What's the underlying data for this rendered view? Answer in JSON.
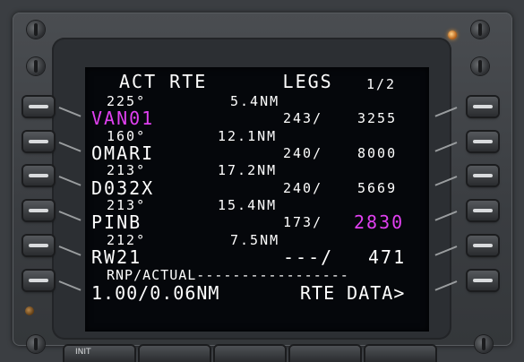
{
  "cdu": {
    "title": "ACT RTE      LEGS",
    "page": "1/2",
    "legs": [
      {
        "course": "225°",
        "distance": "5.4NM",
        "waypoint": "VAN01",
        "waypoint_active": true,
        "speed": "243/",
        "altitude": "3255",
        "altitude_highlight": false
      },
      {
        "course": "160°",
        "distance": "12.1NM",
        "waypoint": "OMARI",
        "waypoint_active": false,
        "speed": "240/",
        "altitude": "8000",
        "altitude_highlight": false
      },
      {
        "course": "213°",
        "distance": "17.2NM",
        "waypoint": "D032X",
        "waypoint_active": false,
        "speed": "240/",
        "altitude": "5669",
        "altitude_highlight": false
      },
      {
        "course": "213°",
        "distance": "15.4NM",
        "waypoint": "PINB",
        "waypoint_active": false,
        "speed": "173/",
        "altitude": "2830",
        "altitude_highlight": true
      },
      {
        "course": "212°",
        "distance": "7.5NM",
        "waypoint": "RW21",
        "waypoint_active": false,
        "speed": "---/",
        "altitude": "471",
        "altitude_highlight": false
      }
    ],
    "rnp_label": "RNP/ACTUAL-----------------",
    "rnp_value": "1.00/0.06NM",
    "rte_data": "RTE DATA>",
    "bottom_key_label": "INIT"
  },
  "colors": {
    "screen": "#05070b",
    "text": "#ffffff",
    "active": "#e040f0"
  }
}
